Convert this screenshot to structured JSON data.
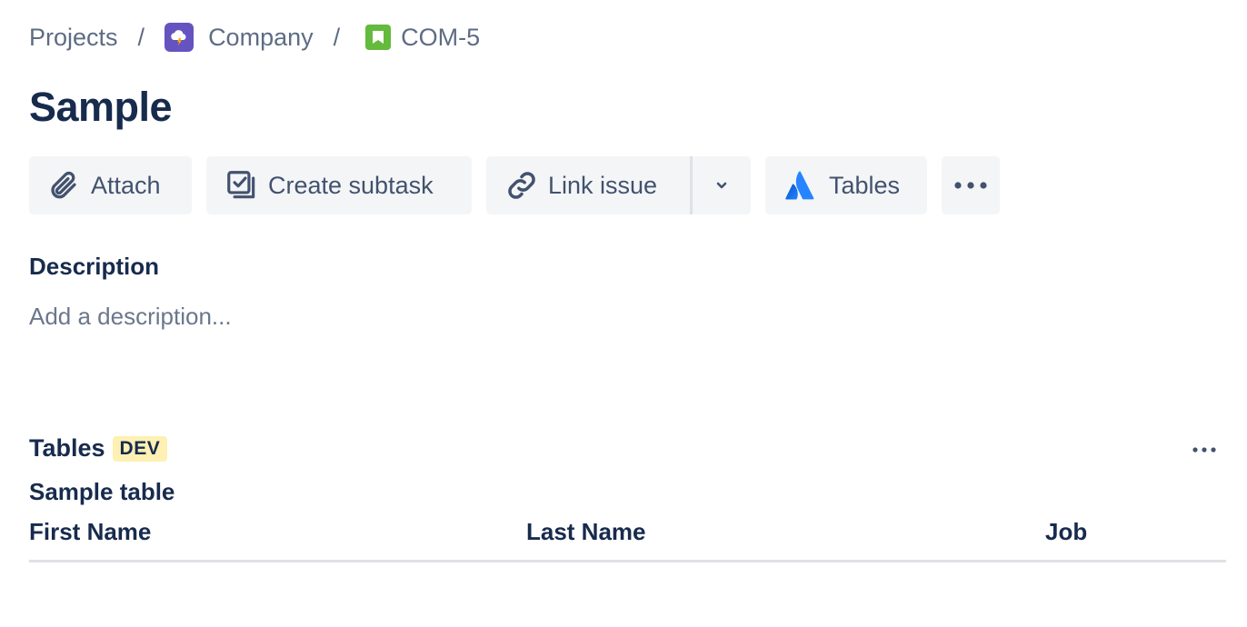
{
  "breadcrumb": {
    "projects": "Projects",
    "separator": "/",
    "project": "Company",
    "issue_key": "COM-5"
  },
  "issue": {
    "title": "Sample"
  },
  "toolbar": {
    "attach_label": "Attach",
    "create_subtask_label": "Create subtask",
    "link_issue_label": "Link issue",
    "tables_label": "Tables"
  },
  "description": {
    "heading": "Description",
    "placeholder": "Add a description..."
  },
  "tables_panel": {
    "title": "Tables",
    "badge": "DEV",
    "table_name": "Sample table",
    "columns": [
      "First Name",
      "Last Name",
      "Job"
    ]
  },
  "colors": {
    "project_avatar": "#6554c0",
    "issue_type": "#63ba3c",
    "badge_bg": "#fff0b3",
    "button_bg": "#f4f5f7",
    "text_primary": "#172b4d",
    "text_subtle": "#5e6c84"
  }
}
